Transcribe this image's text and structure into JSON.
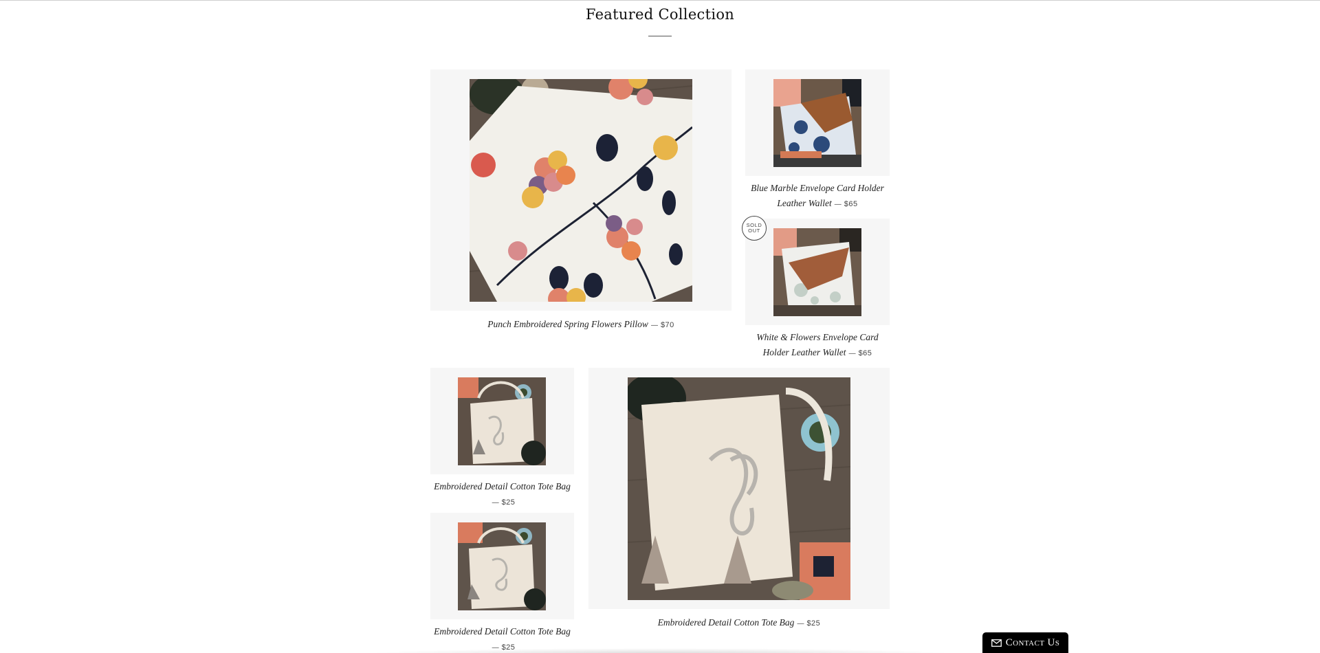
{
  "section": {
    "title": "Featured Collection"
  },
  "products": [
    {
      "name": "Punch Embroidered Spring Flowers Pillow",
      "price": "$70",
      "image": "embroidered-pillow-photo"
    },
    {
      "name": "Blue Marble Envelope Card Holder Leather Wallet",
      "price": "$65",
      "image": "marble-wallet-photo"
    },
    {
      "name": "White & Flowers Envelope Card Holder Leather Wallet",
      "price": "$65",
      "image": "white-flowers-wallet-photo",
      "badge": {
        "line1": "Sold",
        "line2": "Out"
      }
    },
    {
      "name": "Embroidered Detail Cotton Tote Bag",
      "price": "$25",
      "image": "tote-bag-photo"
    },
    {
      "name": "Embroidered Detail Cotton Tote Bag",
      "price": "$25",
      "image": "tote-bag-photo"
    },
    {
      "name": "Embroidered Detail Cotton Tote Bag",
      "price": "$25",
      "image": "tote-bag-photo"
    }
  ],
  "price_separator": "—",
  "contact": {
    "label": "Contact Us",
    "icon": "envelope-icon"
  }
}
